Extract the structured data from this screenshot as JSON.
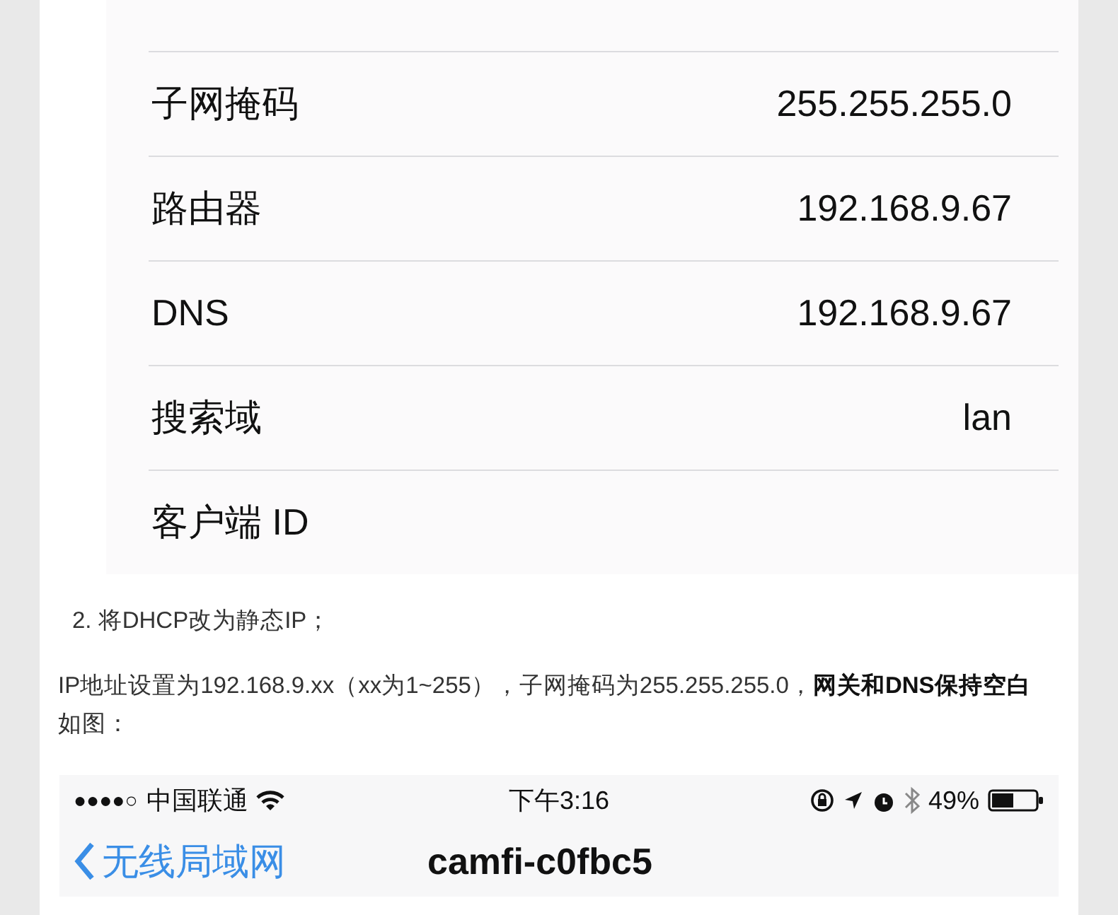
{
  "settings_rows": [
    {
      "label": "子网掩码",
      "value": "255.255.255.0"
    },
    {
      "label": "路由器",
      "value": "192.168.9.67"
    },
    {
      "label": "DNS",
      "value": "192.168.9.67"
    },
    {
      "label": "搜索域",
      "value": "lan"
    },
    {
      "label": "客户端 ID"
    }
  ],
  "step": "2.  将DHCP改为静态IP；",
  "paragraph": "IP地址设置为192.168.9.xx（xx为1~255），子网掩码为255.255.255.0，**网关和DNS保持空白**如图：",
  "phone": {
    "signal": "●●●●○",
    "carrier": "中国联通",
    "time": "下午3:16",
    "battery": "49%",
    "back": "无线局域网",
    "title": "camfi-c0fbc5"
  }
}
